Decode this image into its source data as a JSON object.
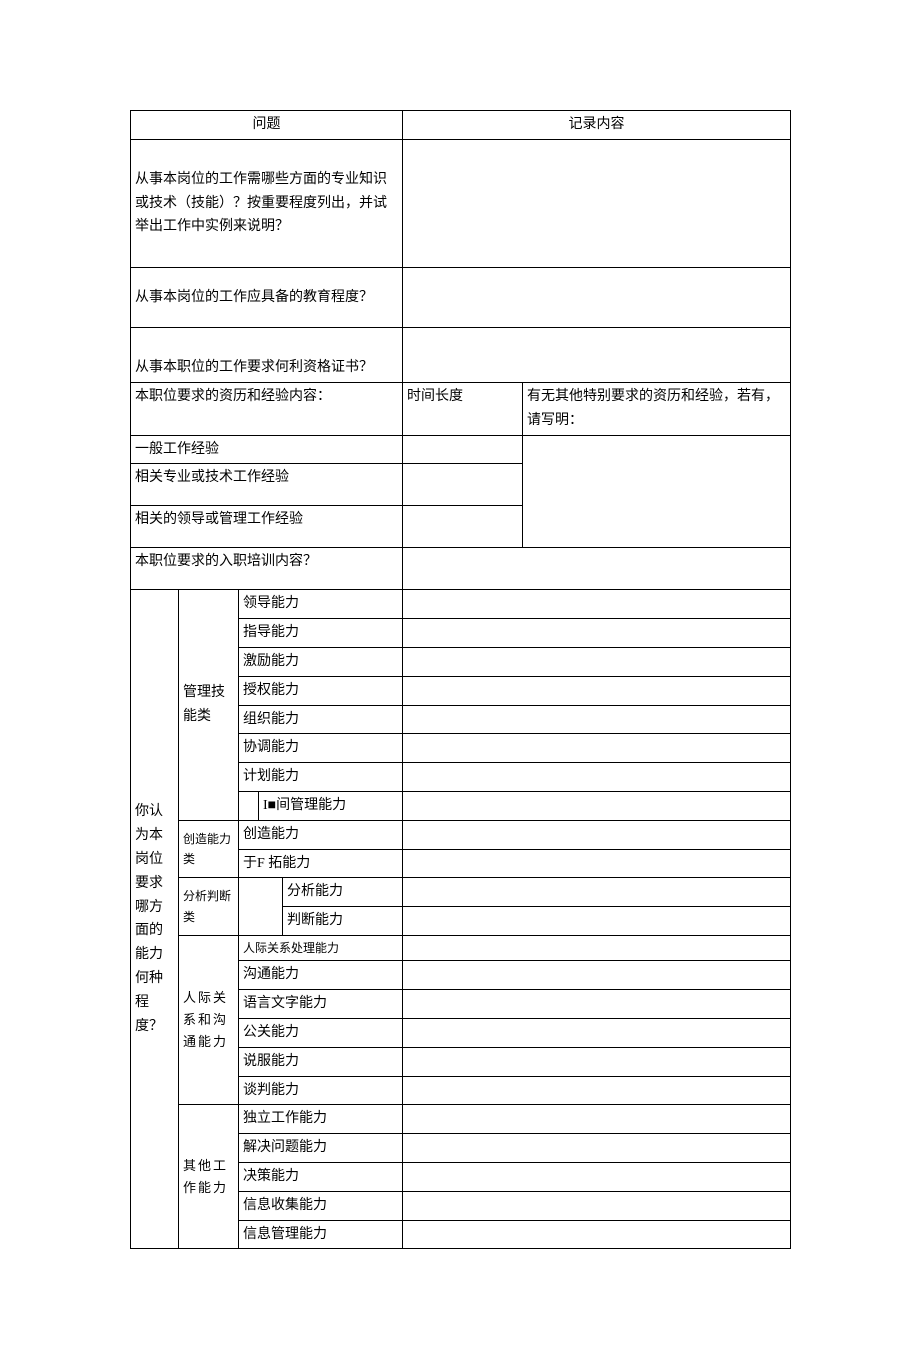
{
  "header": {
    "col1": "问题",
    "col2": "记录内容"
  },
  "q1": "从事本岗位的工作需哪些方面的专业知识或技术（技能）？按重要程度列出，并试举出工作中实例来说明？",
  "q2": "从事本岗位的工作应具备的教育程度？",
  "q3": "从事本职位的工作要求何利资格证书？",
  "exp": {
    "title": "本职位要求的资历和经验内容：",
    "timeLabel": "时间长度",
    "extraLabel": "有无其他特别要求的资历和经验，若有，请写明：",
    "row1": "一般工作经验",
    "row2": "相关专业或技术工作经验",
    "row3": "相关的领导或管理工作经验"
  },
  "training": "本职位要求的入职培训内容？",
  "bigQ": "你认为本岗位要求哪方面的能力何种程度？",
  "cat": {
    "mgmt": "管理技能类",
    "create": "创造能力类",
    "analysis": "分析判断类",
    "interpersonal": "人际关系和沟通能力",
    "other": "其他工作能力"
  },
  "skills": {
    "m1": "领导能力",
    "m2": "指导能力",
    "m3": "激励能力",
    "m4": "授权能力",
    "m5": "组织能力",
    "m6": "协调能力",
    "m7": "计划能力",
    "m8": "I■间管理能力",
    "c1": "创造能力",
    "c2": "于F 拓能力",
    "a1": "分析能力",
    "a2": "判断能力",
    "i1": "人际关系处理能力",
    "i2": "沟通能力",
    "i3": "语言文字能力",
    "i4": "公关能力",
    "i5": "说服能力",
    "i6": "谈判能力",
    "o1": "独立工作能力",
    "o2": "解决问题能力",
    "o3": "决策能力",
    "o4": "信息收集能力",
    "o5": "信息管理能力"
  }
}
